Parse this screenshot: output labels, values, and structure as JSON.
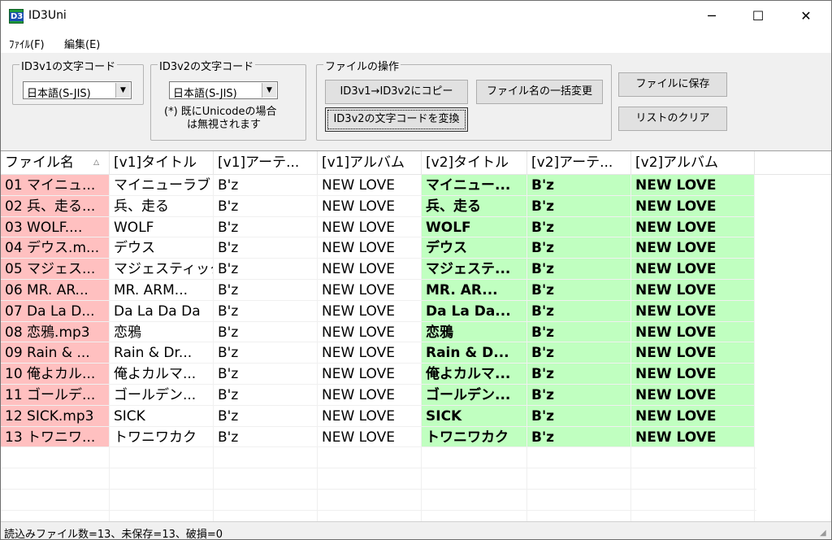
{
  "window": {
    "title": "ID3Uni",
    "icon_text": "D3",
    "minimize": "─",
    "maximize": "☐",
    "close": "✕"
  },
  "menu": [
    {
      "label": "ﾌｧｲﾙ(F)"
    },
    {
      "label": "編集(E)"
    }
  ],
  "v1group": {
    "label": "ID3v1の文字コード",
    "selected": "日本語(S-JIS)"
  },
  "v2group": {
    "label": "ID3v2の文字コード",
    "selected": "日本語(S-JIS)",
    "note1": "(*)  既にUnicodeの場合",
    "note2": "は無視されます"
  },
  "filegroup": {
    "label": "ファイルの操作",
    "copy_button": "ID3v1→ID3v2にコピー",
    "rename_button": "ファイル名の一括変更",
    "convert_button": "ID3v2の文字コードを変換"
  },
  "save_button": "ファイルに保存",
  "clear_button": "リストのクリア",
  "columns": [
    "ファイル名",
    "[v1]タイトル",
    "[v1]アーテ...",
    "[v1]アルバム",
    "[v2]タイトル",
    "[v2]アーテ...",
    "[v2]アルバム"
  ],
  "sort_indicator": "△",
  "rows": [
    [
      "01 マイニュ...",
      "マイニューラブ",
      "B'z",
      "NEW LOVE",
      "マイニュー...",
      "B'z",
      "NEW LOVE"
    ],
    [
      "02 兵、走る...",
      "兵、走る",
      "B'z",
      "NEW LOVE",
      "兵、走る",
      "B'z",
      "NEW LOVE"
    ],
    [
      "03 WOLF....",
      "WOLF",
      "B'z",
      "NEW LOVE",
      "WOLF",
      "B'z",
      "NEW LOVE"
    ],
    [
      "04 デウス.m...",
      "デウス",
      "B'z",
      "NEW LOVE",
      "デウス",
      "B'z",
      "NEW LOVE"
    ],
    [
      "05 マジェス...",
      "マジェスティック",
      "B'z",
      "NEW LOVE",
      "マジェステ...",
      "B'z",
      "NEW LOVE"
    ],
    [
      "06 MR. AR...",
      "MR. ARM...",
      "B'z",
      "NEW LOVE",
      "MR. AR...",
      "B'z",
      "NEW LOVE"
    ],
    [
      "07 Da La D...",
      "Da La Da Da",
      "B'z",
      "NEW LOVE",
      "Da La Da...",
      "B'z",
      "NEW LOVE"
    ],
    [
      "08 恋鴉.mp3",
      "恋鴉",
      "B'z",
      "NEW LOVE",
      "恋鴉",
      "B'z",
      "NEW LOVE"
    ],
    [
      "09 Rain & ...",
      "Rain & Dr...",
      "B'z",
      "NEW LOVE",
      "Rain & D...",
      "B'z",
      "NEW LOVE"
    ],
    [
      "10 俺よカル...",
      "俺よカルマ...",
      "B'z",
      "NEW LOVE",
      "俺よカルマ...",
      "B'z",
      "NEW LOVE"
    ],
    [
      "11 ゴールデ...",
      "ゴールデン...",
      "B'z",
      "NEW LOVE",
      "ゴールデン...",
      "B'z",
      "NEW LOVE"
    ],
    [
      "12 SICK.mp3",
      "SICK",
      "B'z",
      "NEW LOVE",
      "SICK",
      "B'z",
      "NEW LOVE"
    ],
    [
      "13 トワニワ...",
      "トワニワカク",
      "B'z",
      "NEW LOVE",
      "トワニワカク",
      "B'z",
      "NEW LOVE"
    ]
  ],
  "status": "読込みファイル数=13、未保存=13、破損=0",
  "colors": {
    "filename_bg": "#ffc0c0",
    "v2_bg": "#c0ffc0"
  }
}
